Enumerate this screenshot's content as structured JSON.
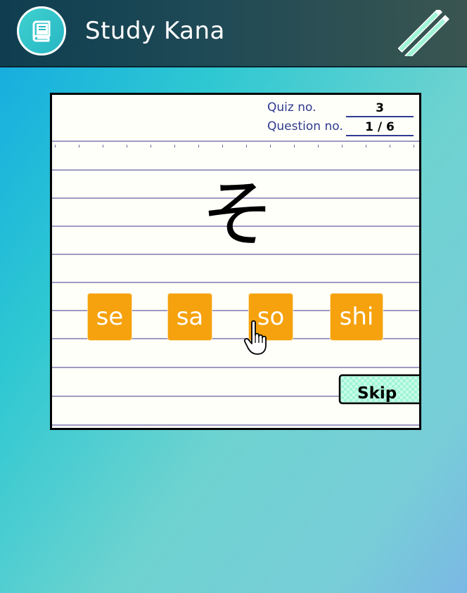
{
  "header": {
    "title": "Study Kana",
    "logo_icon": "book-icon",
    "menu_icon": "pencils-icon"
  },
  "quiz": {
    "quiz_label": "Quiz no.",
    "quiz_value": "3",
    "question_label": "Question no.",
    "question_value": "1 / 6",
    "kana": "そ",
    "choices": [
      "se",
      "sa",
      "so",
      "shi"
    ],
    "skip_label": "Skip"
  },
  "colors": {
    "choice_bg": "#f5a20e",
    "header_bg": "#1f4a56",
    "skip_bg": "#9ff5d6",
    "rule": "#9d9bc3"
  }
}
